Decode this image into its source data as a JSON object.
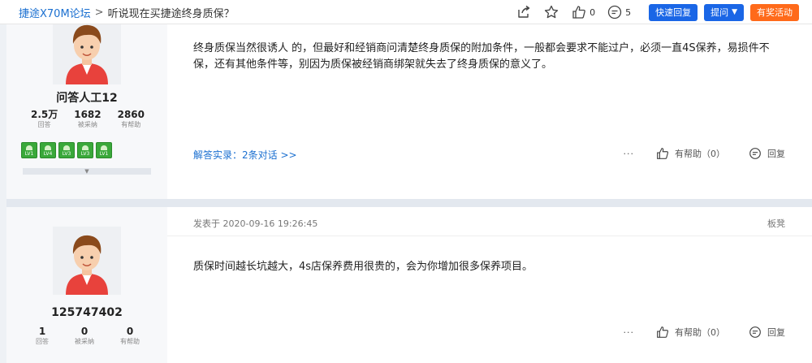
{
  "breadcrumb": {
    "forum": "捷途X70M论坛",
    "separator": ">",
    "topic": "听说现在买捷途终身质保？"
  },
  "toolbar": {
    "share_icon": "share-icon",
    "favorite_icon": "star-icon",
    "like_count": "0",
    "comment_count": "5",
    "quick_reply_label": "快速回复",
    "ask_label": "提问",
    "prize_label": "有奖活动"
  },
  "posts": [
    {
      "username": "问答人工12",
      "stats": [
        {
          "value": "2.5万",
          "label": "回答"
        },
        {
          "value": "1682",
          "label": "被采纳"
        },
        {
          "value": "2860",
          "label": "有帮助"
        }
      ],
      "badges": [
        "LV1",
        "LV4",
        "LV3",
        "LV3",
        "LV1"
      ],
      "text": "终身质保当然很诱人 的，但最好和经销商问清楚终身质保的附加条件，一般都会要求不能过户，必须一直4S保养，易损件不保，还有其他条件等，别因为质保被经销商绑架就失去了终身质保的意义了。",
      "dialog_link": "解答实录：2条对话 >>",
      "more": "···",
      "helpful_label": "有帮助（0）",
      "reply_label": "回复"
    },
    {
      "username": "125747402",
      "stats": [
        {
          "value": "1",
          "label": "回答"
        },
        {
          "value": "0",
          "label": "被采纳"
        },
        {
          "value": "0",
          "label": "有帮助"
        }
      ],
      "posted_at": "发表于 2020-09-16 19:26:45",
      "floor": "板凳",
      "text": "质保时间越长坑越大，4s店保养费用很贵的，会为你增加很多保养项目。",
      "more": "···",
      "helpful_label": "有帮助（0）",
      "reply_label": "回复"
    }
  ],
  "colors": {
    "link_blue": "#1a6fd0",
    "button_blue": "#1a66e6",
    "button_orange": "#ff6a1a",
    "badge_green": "#3aa83a"
  }
}
